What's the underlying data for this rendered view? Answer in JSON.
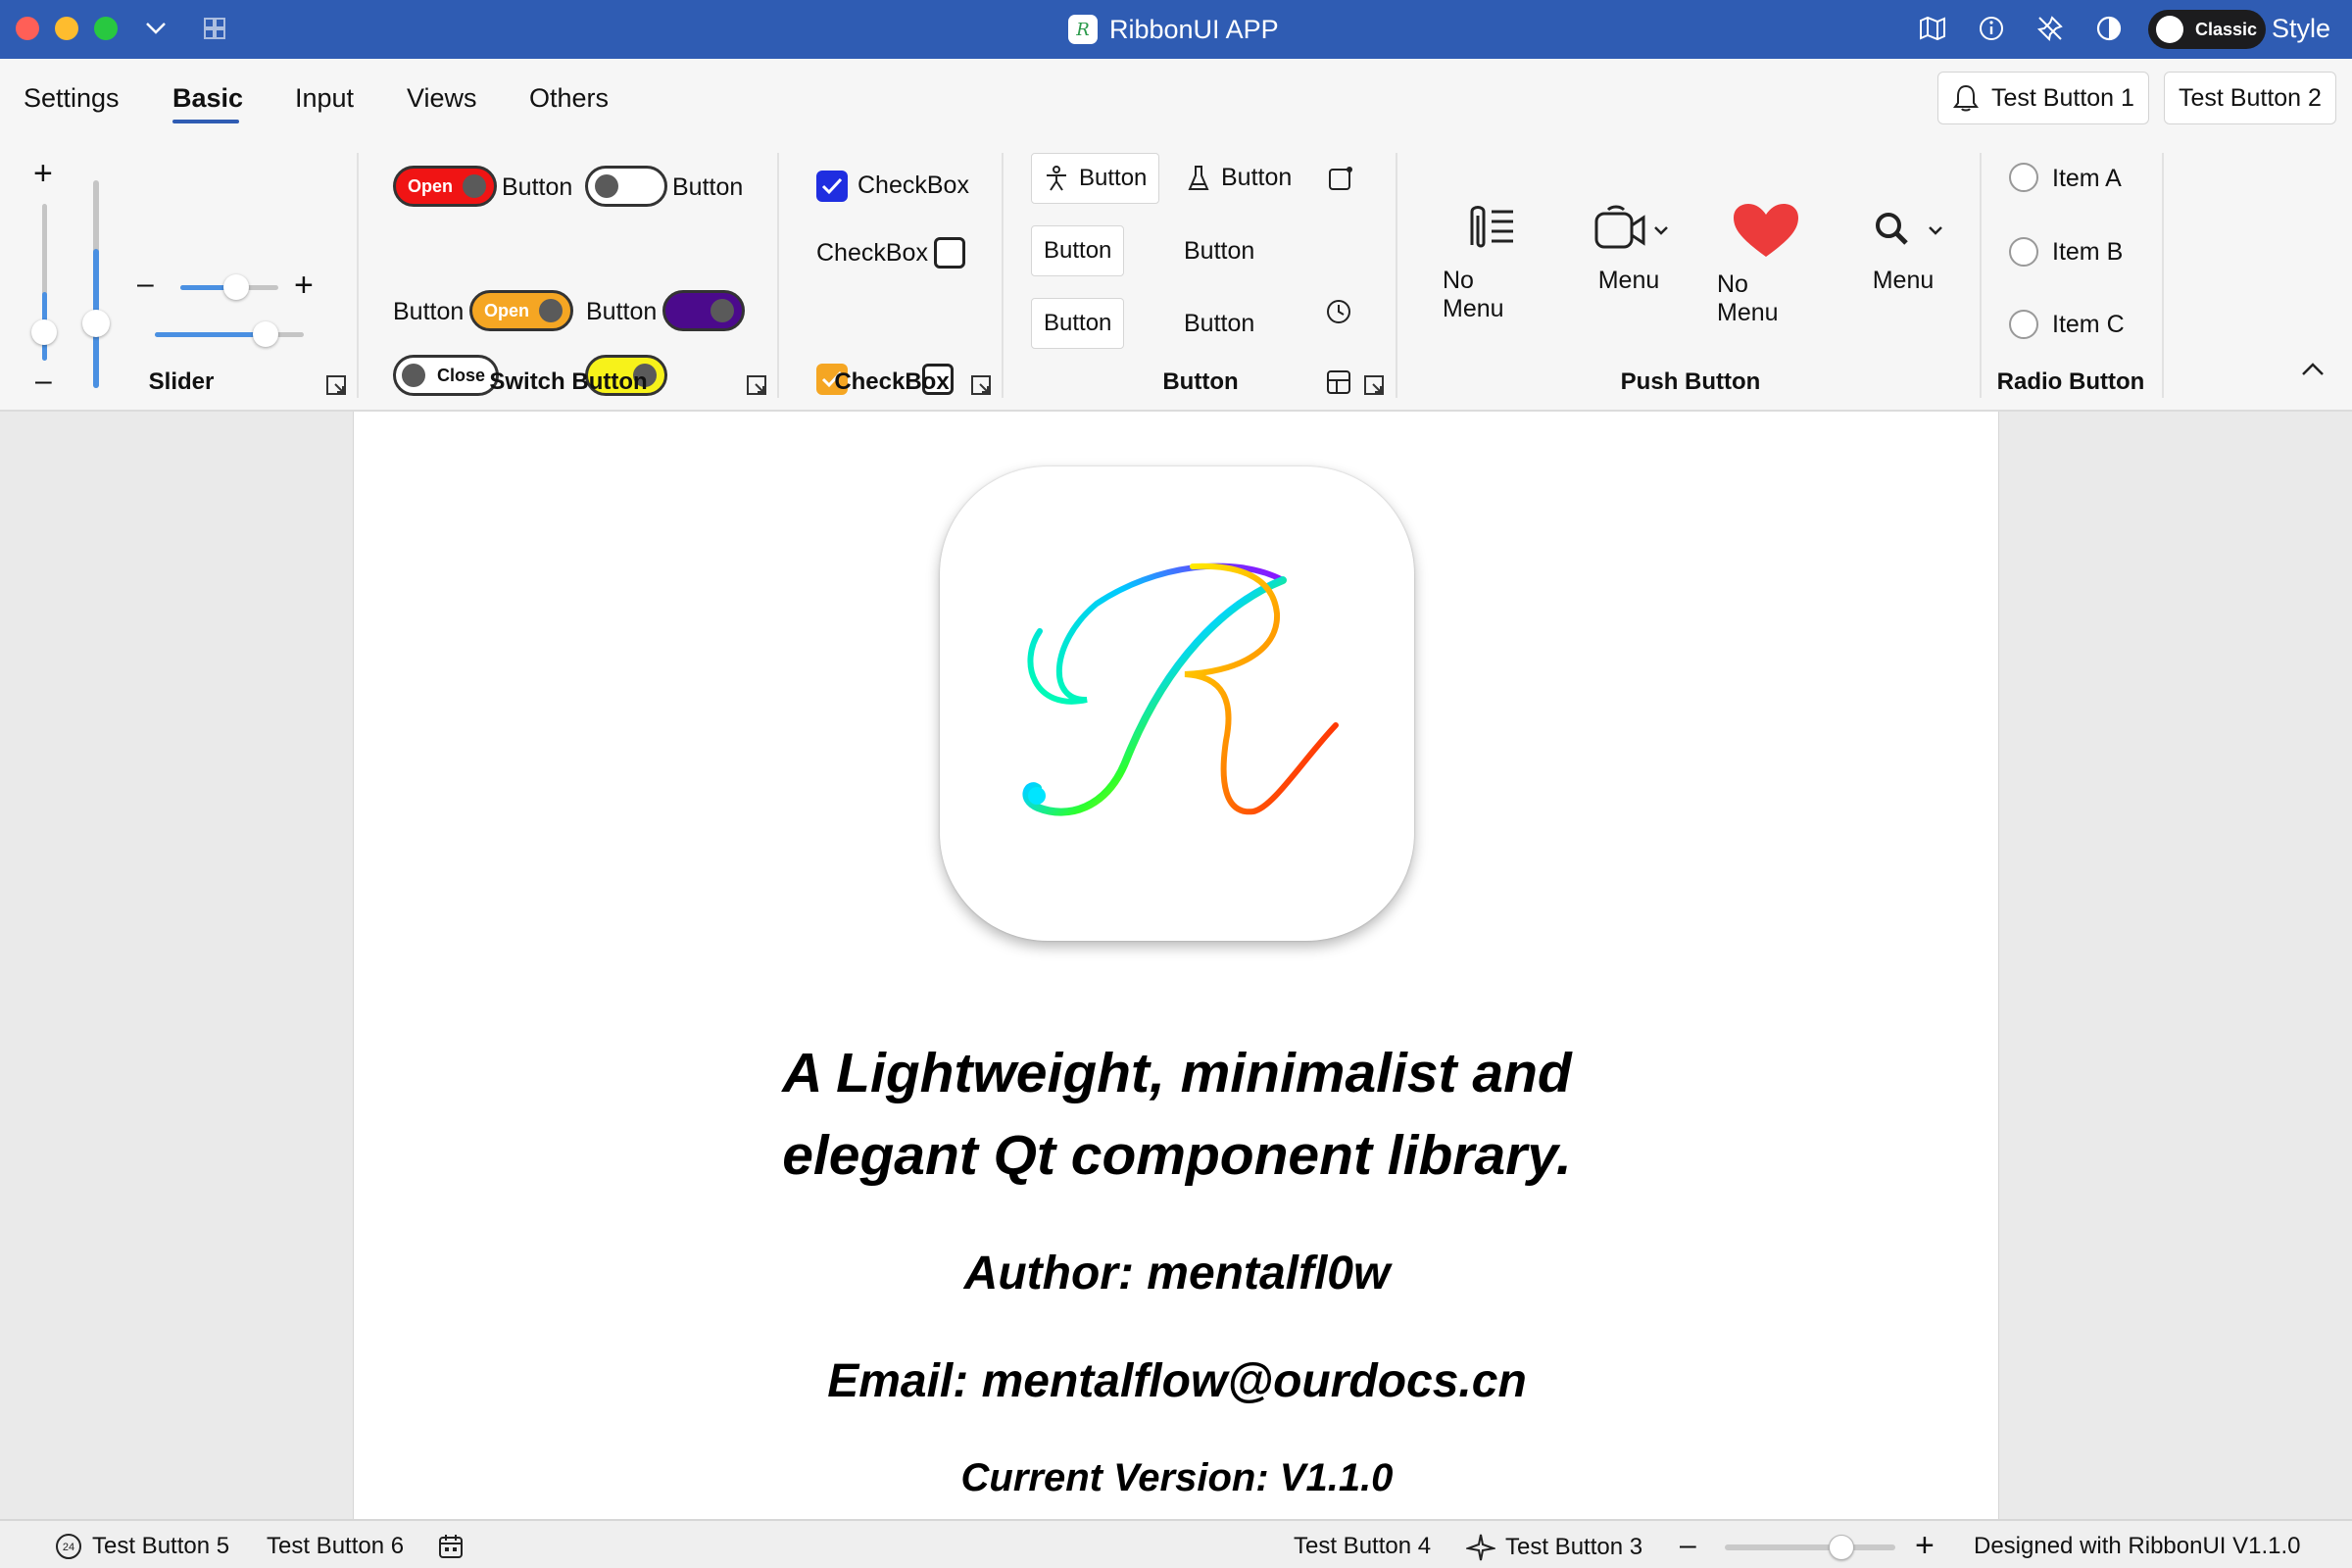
{
  "window": {
    "title": "RibbonUI APP",
    "style_toggle_label": "Classic",
    "style_label": "Style"
  },
  "titlebar_icons": [
    "chevron-down-icon",
    "layout-icon",
    "map-icon",
    "info-icon",
    "pin-off-icon",
    "theme-contrast-icon"
  ],
  "tabs": [
    {
      "label": "Settings",
      "active": false
    },
    {
      "label": "Basic",
      "active": true
    },
    {
      "label": "Input",
      "active": false
    },
    {
      "label": "Views",
      "active": false
    },
    {
      "label": "Others",
      "active": false
    }
  ],
  "top_buttons": {
    "test1": "Test Button 1",
    "test2": "Test Button 2"
  },
  "groups": {
    "slider": {
      "title": "Slider"
    },
    "switch": {
      "title": "Switch Button",
      "button_label": "Button",
      "open_label": "Open",
      "close_label": "Close",
      "colors": {
        "red": "#f01414",
        "orange": "#f5a623",
        "purple": "#4b0a8c",
        "yellow": "#f7f21a"
      }
    },
    "checkbox": {
      "title": "CheckBox",
      "label": "CheckBox",
      "colors": {
        "blue": "#1f2ee0",
        "orange": "#f5a623"
      }
    },
    "button": {
      "title": "Button",
      "label": "Button"
    },
    "push": {
      "title": "Push Button",
      "items": [
        {
          "label": "No Menu",
          "icon": "paperclip-list-icon"
        },
        {
          "label": "Menu",
          "icon": "video-camera-icon"
        },
        {
          "label": "No Menu",
          "icon": "heart-icon"
        },
        {
          "label": "Menu",
          "icon": "search-icon"
        }
      ]
    },
    "radio": {
      "title": "Radio Button",
      "items": [
        "Item A",
        "Item B",
        "Item C"
      ]
    }
  },
  "content": {
    "headline_line1": "A Lightweight, minimalist and",
    "headline_line2": "elegant Qt component library.",
    "author": "Author: mentalfl0w",
    "email": "Email: mentalflow@ourdocs.cn",
    "version": "Current Version: V1.1.0"
  },
  "statusbar": {
    "test5": "Test Button 5",
    "test6": "Test Button 6",
    "test4": "Test Button 4",
    "test3": "Test Button 3",
    "designed": "Designed with RibbonUI V1.1.0",
    "zoom_level": 0.62,
    "badge_number": "24"
  }
}
